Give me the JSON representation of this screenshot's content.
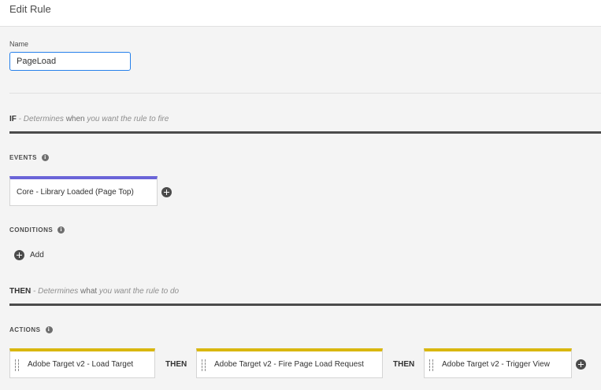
{
  "header": {
    "title": "Edit Rule"
  },
  "name_field": {
    "label": "Name",
    "value": "PageLoad"
  },
  "if_section": {
    "keyword": "IF",
    "desc_prefix": " - Determines ",
    "desc_em": "when",
    "desc_suffix": " you want the rule to fire"
  },
  "events": {
    "label": "EVENTS",
    "items": [
      "Core - Library Loaded (Page Top)"
    ]
  },
  "conditions": {
    "label": "CONDITIONS",
    "add_label": "Add"
  },
  "then_section": {
    "keyword": "THEN",
    "desc_prefix": " - Determines ",
    "desc_em": "what",
    "desc_suffix": " you want the rule to do"
  },
  "actions": {
    "label": "ACTIONS",
    "items": [
      "Adobe Target v2 - Load Target",
      "Adobe Target v2 - Fire Page Load Request",
      "Adobe Target v2 - Trigger View"
    ],
    "connector": "THEN"
  },
  "colors": {
    "event_accent": "#6a64d8",
    "action_accent": "#d9b70f",
    "focus_border": "#2680eb"
  }
}
